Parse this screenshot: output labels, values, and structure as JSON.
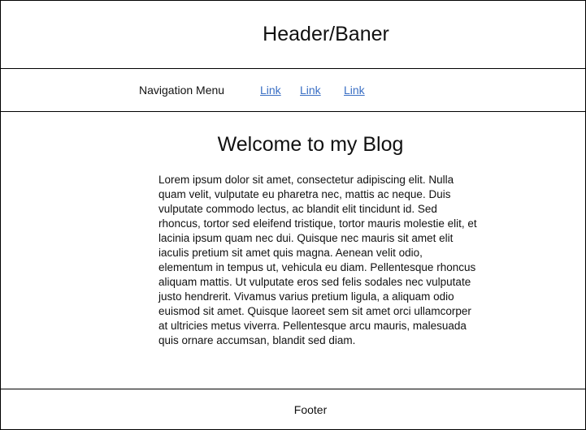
{
  "header": {
    "title": "Header/Baner"
  },
  "nav": {
    "label": "Navigation Menu",
    "links": [
      "Link",
      "Link",
      "Link"
    ],
    "link_color": "#3a6fc4"
  },
  "main": {
    "title": "Welcome to my Blog",
    "body": "Lorem ipsum dolor sit amet, consectetur adipiscing elit. Nulla quam velit, vulputate eu pharetra nec, mattis ac neque. Duis vulputate commodo lectus, ac blandit elit tincidunt id. Sed rhoncus, tortor sed eleifend tristique, tortor mauris molestie elit, et lacinia ipsum quam nec dui. Quisque nec mauris sit amet elit iaculis pretium sit amet quis magna. Aenean velit odio, elementum in tempus ut, vehicula eu diam. Pellentesque rhoncus aliquam mattis. Ut vulputate eros sed felis sodales nec vulputate justo hendrerit. Vivamus varius pretium ligula, a aliquam odio euismod sit amet. Quisque laoreet sem sit amet orci ullamcorper at ultricies metus viverra. Pellentesque arcu mauris, malesuada quis ornare accumsan, blandit sed diam."
  },
  "footer": {
    "label": "Footer"
  }
}
